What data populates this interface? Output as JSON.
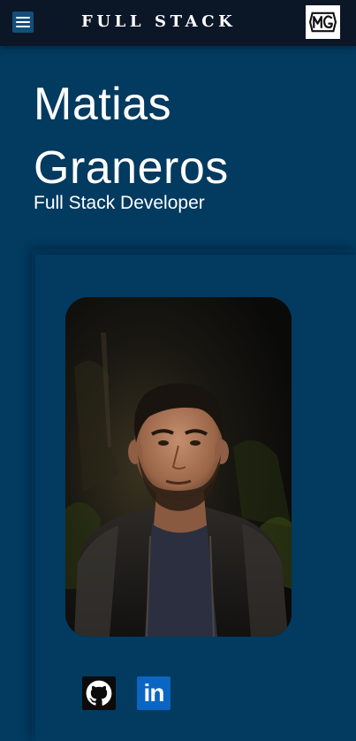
{
  "header": {
    "brand": "FULL STACK",
    "menu_icon": "hamburger-menu-icon",
    "logo_icon": "mg-monogram-logo"
  },
  "hero": {
    "first_name": "Matias",
    "last_name": "Graneros",
    "role": "Full Stack Developer"
  },
  "profile": {
    "photo_icon": "profile-photo"
  },
  "social": {
    "github_icon": "github-icon",
    "linkedin_icon": "linkedin-icon",
    "linkedin_glyph": "in"
  },
  "colors": {
    "page_bg": "#023a60",
    "topbar_bg": "#0b1627",
    "menu_button_bg": "#144e7a",
    "linkedin_blue": "#0a66c2"
  }
}
